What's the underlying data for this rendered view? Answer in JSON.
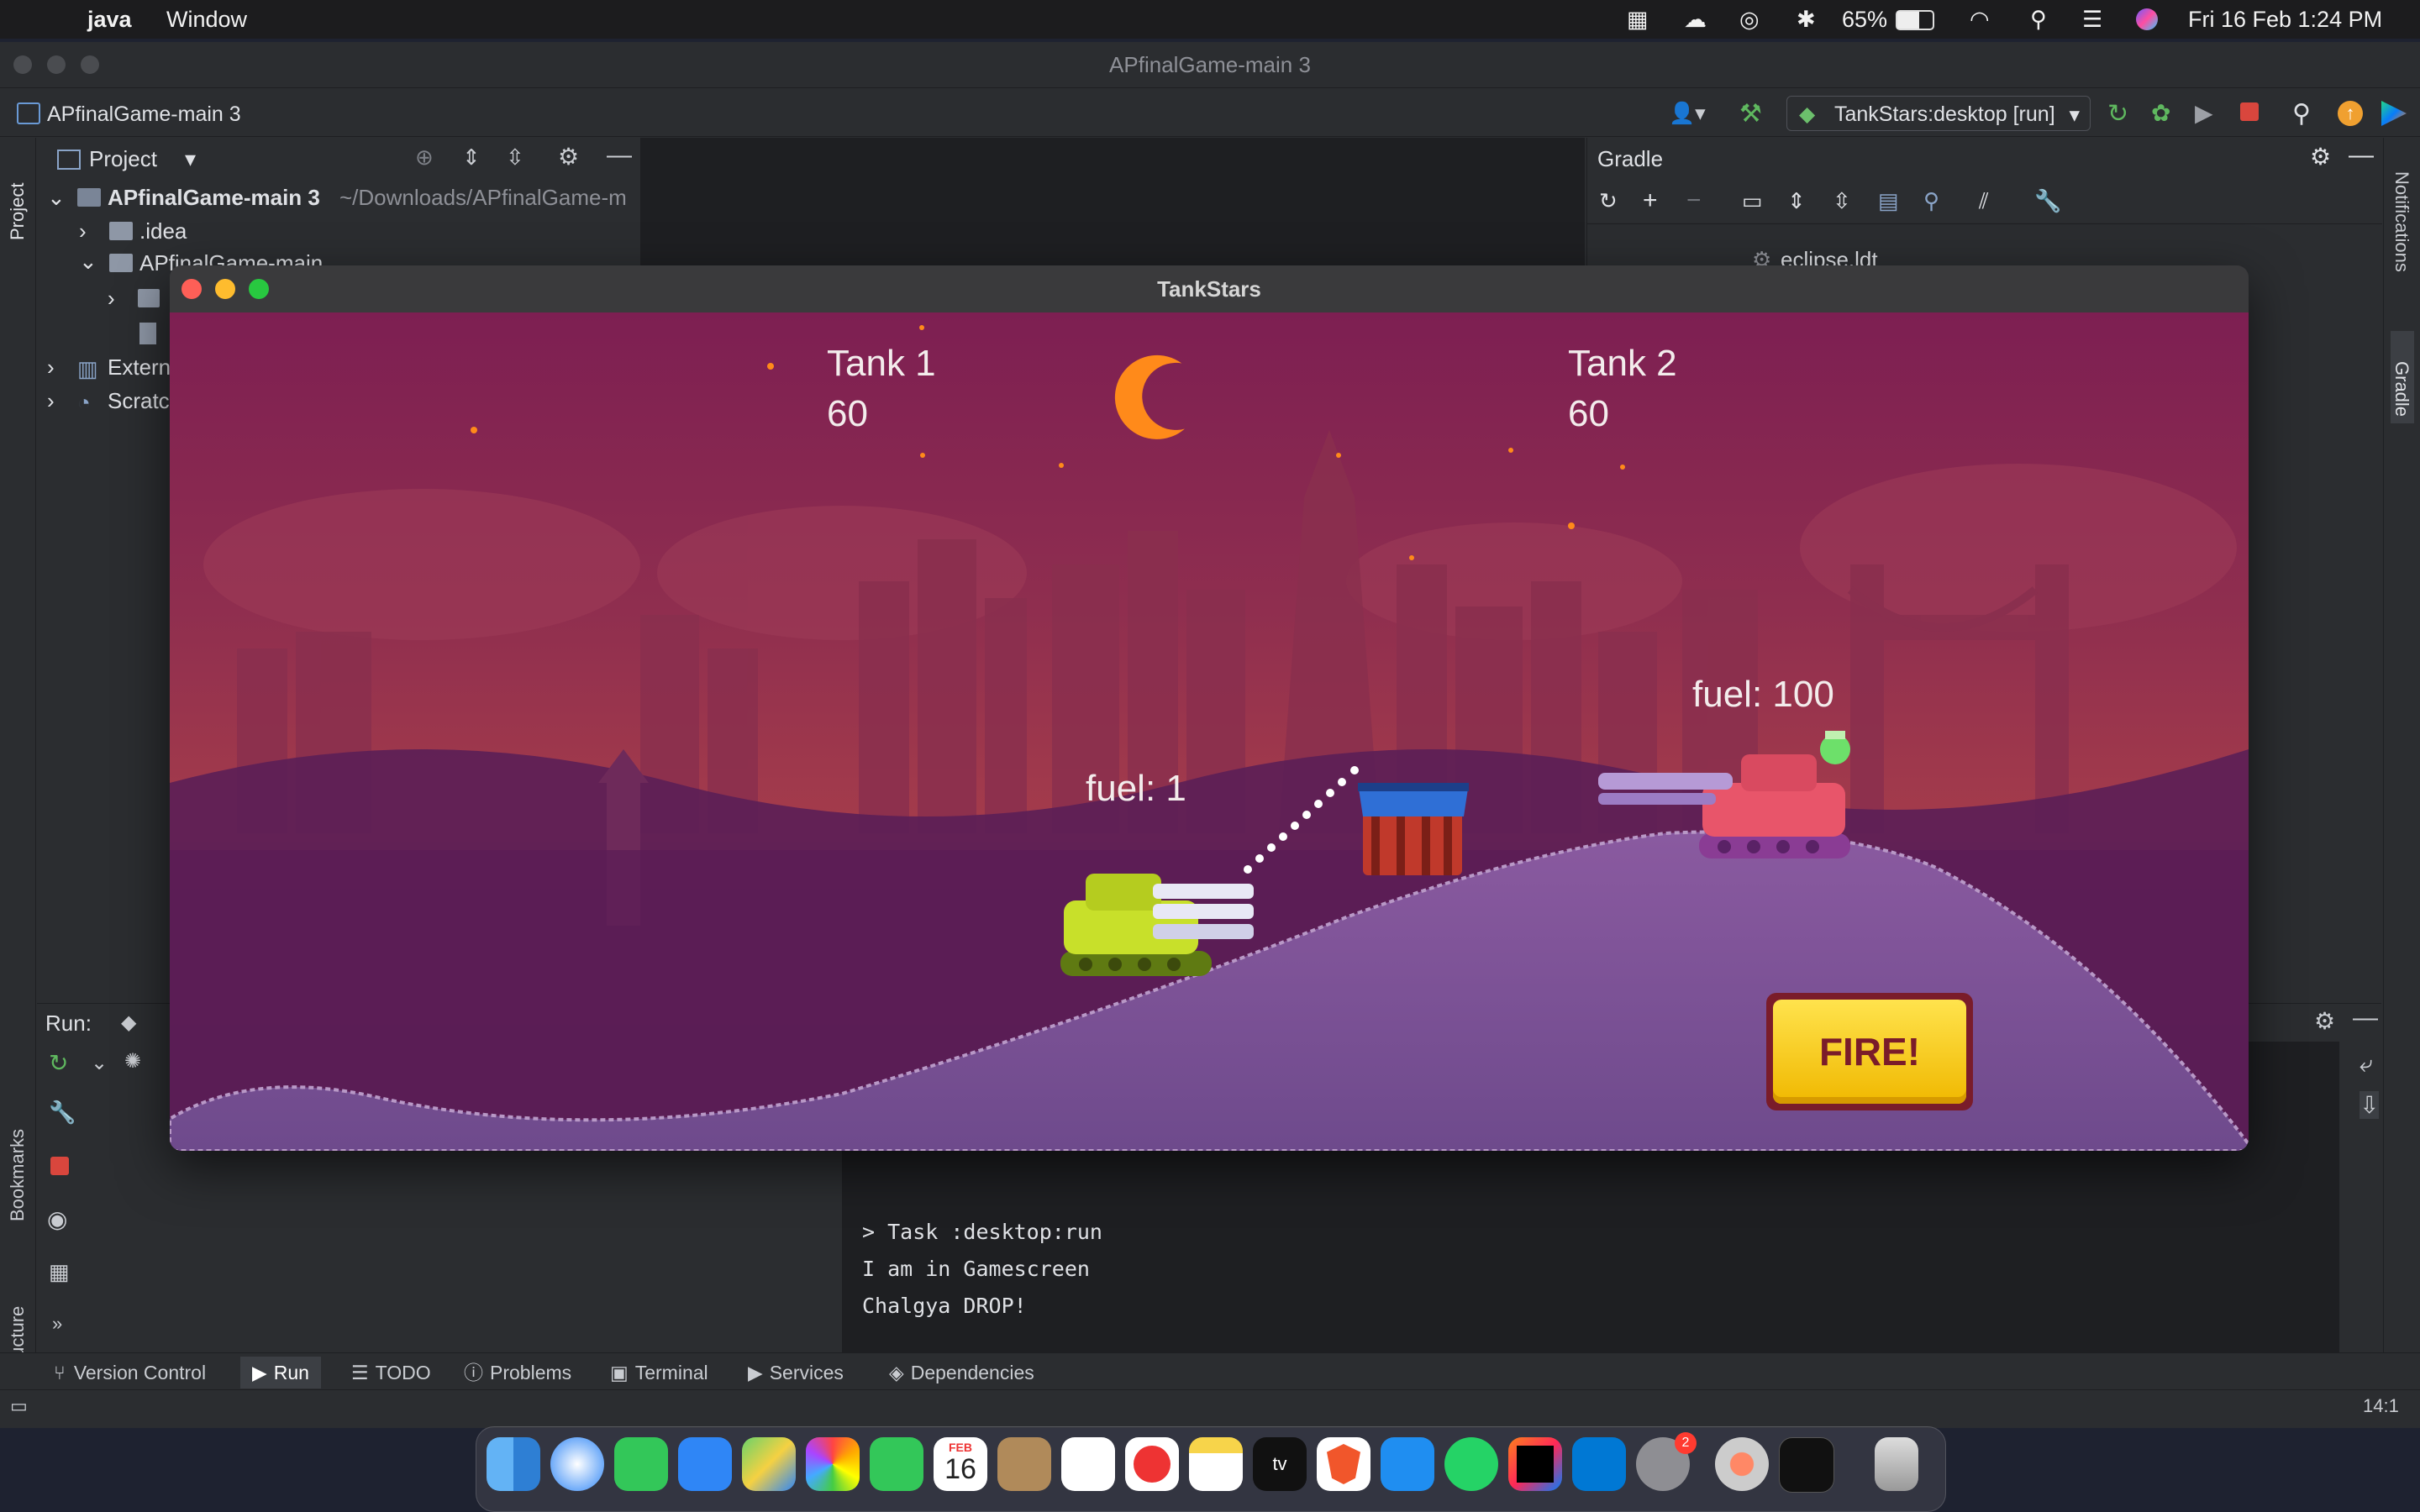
{
  "menubar": {
    "app": "java",
    "window": "Window",
    "battery": "65%",
    "datetime": "Fri 16 Feb  1:24 PM"
  },
  "ide": {
    "window_title": "APfinalGame-main 3",
    "project_name": "APfinalGame-main 3",
    "run_config": "TankStars:desktop [run]",
    "project_panel": {
      "title": "Project",
      "root": "APfinalGame-main 3",
      "root_path": "~/Downloads/APfinalGame-m",
      "items": [
        ".idea",
        "APfinalGame-main",
        "Extern",
        "Scratc"
      ]
    },
    "gradle_panel": {
      "title": "Gradle",
      "items": [
        "eclipse.ldt"
      ]
    },
    "side_labels": {
      "project": "Project",
      "bookmarks": "Bookmarks",
      "structure": "Structure",
      "notifications": "Notifications",
      "gradle": "Gradle"
    },
    "run_panel": {
      "label": "Run:",
      "console_lines": [
        "> Task :desktop:run",
        "I am in Gamescreen",
        "Chalgya DROP!"
      ]
    },
    "bottom_tabs": [
      "Version Control",
      "Run",
      "TODO",
      "Problems",
      "Terminal",
      "Services",
      "Dependencies"
    ],
    "cursor_position": "14:1"
  },
  "game": {
    "title": "TankStars",
    "tank1": {
      "label": "Tank 1",
      "health": "60",
      "fuel": "fuel: 1"
    },
    "tank2": {
      "label": "Tank 2",
      "health": "60",
      "fuel": "fuel: 100"
    },
    "fire_button": "FIRE!"
  },
  "dock": {
    "calendar_month": "FEB",
    "calendar_day": "16",
    "settings_badge": "2"
  }
}
